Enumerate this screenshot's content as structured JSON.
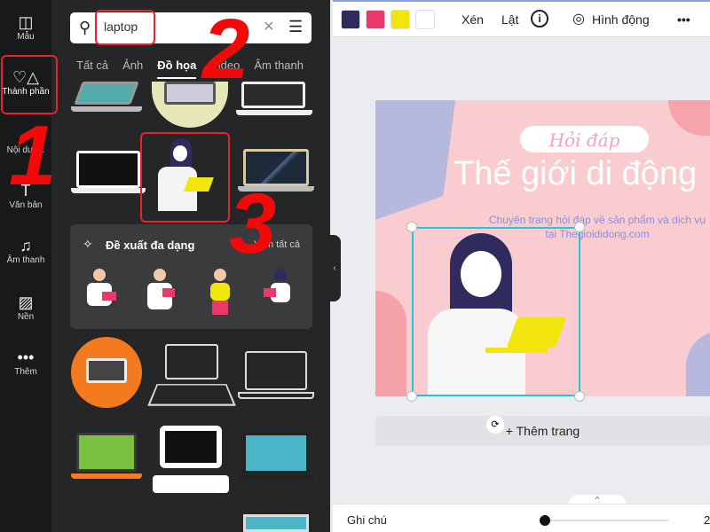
{
  "sidebar": {
    "items": [
      {
        "label": "Mẫu",
        "icon": "layout-icon"
      },
      {
        "label": "Thành phần",
        "icon": "shapes-icon"
      },
      {
        "label": "Nội dun...",
        "icon": "content-icon"
      },
      {
        "label": "Văn bản",
        "icon": "text-icon"
      },
      {
        "label": "Âm thanh",
        "icon": "music-icon"
      },
      {
        "label": "Nền",
        "icon": "background-icon"
      },
      {
        "label": "Thêm",
        "icon": "more-icon"
      }
    ]
  },
  "panel": {
    "search": {
      "value": "laptop"
    },
    "tabs": [
      "Tất cả",
      "Ảnh",
      "Đồ họa",
      "Video",
      "Âm thanh"
    ],
    "active_tab": "Đồ họa",
    "suggestions": {
      "title": "Đề xuất đa dạng",
      "see_all": "Xem tất cả"
    }
  },
  "toolbar": {
    "colors": [
      "#2f2b5e",
      "#e8396a",
      "#f2e50b",
      "#ffffff"
    ],
    "crop": "Xén",
    "flip": "Lật",
    "animate": "Hình động",
    "more": "•••"
  },
  "canvas": {
    "pill": "Hỏi đáp",
    "title": "Thế giới di động",
    "subtitle1": "Chuyên trang hỏi đáp về sản phẩm và dịch vụ",
    "subtitle2": "tại Thegioididong.com",
    "add_page": "+ Thêm trang"
  },
  "bottom": {
    "notes": "Ghi chú",
    "zoom": "2"
  },
  "annotations": [
    "1",
    "2",
    "3"
  ]
}
